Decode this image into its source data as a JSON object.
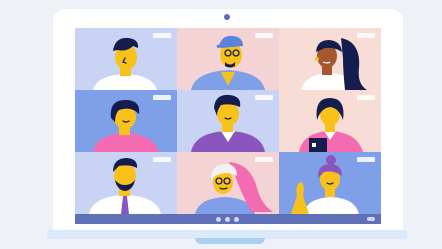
{
  "app": {
    "participants": [
      {
        "position": "top-left",
        "background": "#c9d3f3"
      },
      {
        "position": "top-center",
        "background": "#f3d3d3"
      },
      {
        "position": "top-right",
        "background": "#f8dcd6"
      },
      {
        "position": "middle-left",
        "background": "#7f9fe8"
      },
      {
        "position": "middle-center",
        "background": "#c9d3f3"
      },
      {
        "position": "middle-right",
        "background": "#f8dcd6"
      },
      {
        "position": "bottom-left",
        "background": "#c9d3f3"
      },
      {
        "position": "bottom-center",
        "background": "#f3d3d3"
      },
      {
        "position": "bottom-right",
        "background": "#7f9fe8"
      }
    ],
    "controls": [
      "mic-icon",
      "camera-icon",
      "share-icon",
      "end-call-icon"
    ],
    "colors": {
      "frame": "#2e3a8c",
      "skin": "#f9c21b",
      "hair": "#151d4f",
      "control_bar": "#5f6fb8"
    }
  }
}
